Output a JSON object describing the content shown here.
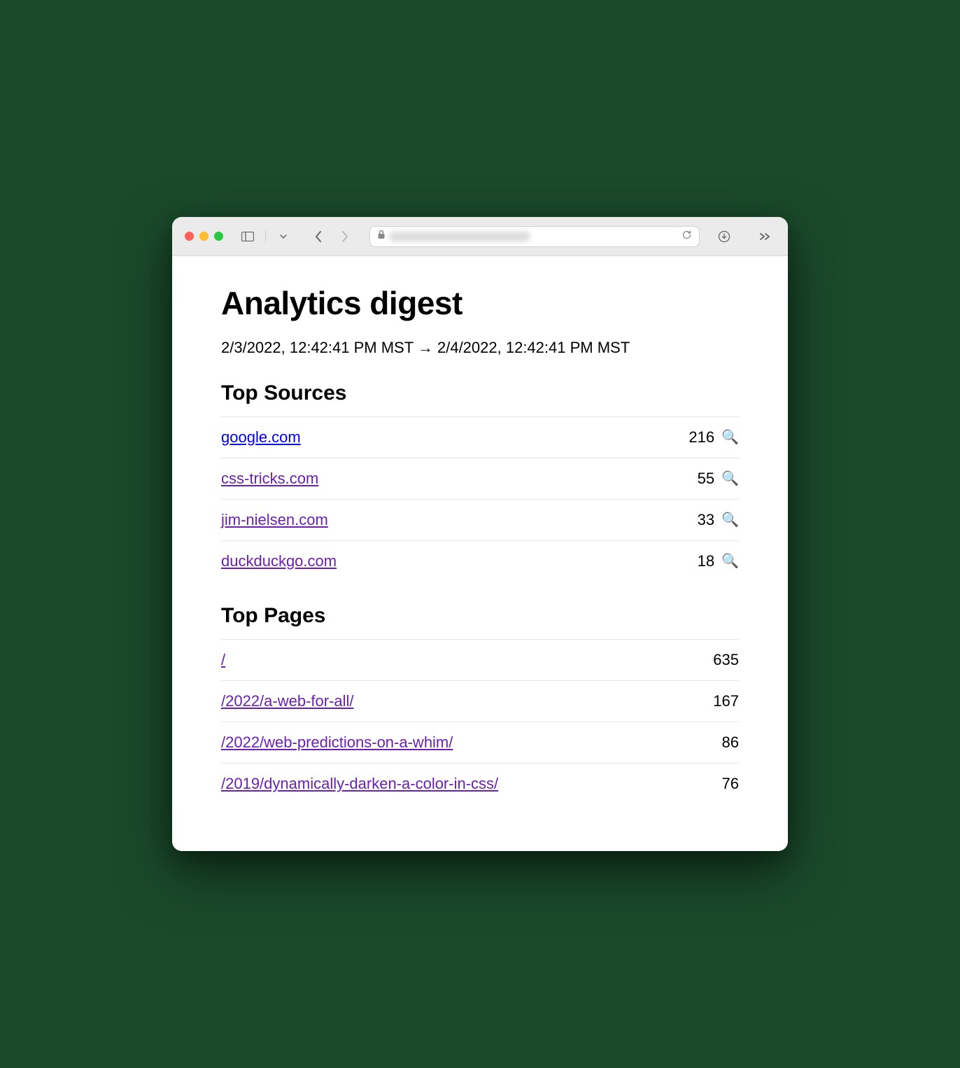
{
  "page": {
    "title": "Analytics digest",
    "date_range": "2/3/2022, 12:42:41 PM MST → 2/4/2022, 12:42:41 PM MST"
  },
  "sections": {
    "sources": {
      "heading": "Top Sources",
      "items": [
        {
          "label": "google.com",
          "value": "216",
          "unvisited": true
        },
        {
          "label": "css-tricks.com",
          "value": "55",
          "unvisited": false
        },
        {
          "label": "jim-nielsen.com",
          "value": "33",
          "unvisited": false
        },
        {
          "label": "duckduckgo.com",
          "value": "18",
          "unvisited": false
        }
      ]
    },
    "pages": {
      "heading": "Top Pages",
      "items": [
        {
          "label": "/",
          "value": "635"
        },
        {
          "label": "/2022/a-web-for-all/",
          "value": "167"
        },
        {
          "label": "/2022/web-predictions-on-a-whim/",
          "value": "86"
        },
        {
          "label": "/2019/dynamically-darken-a-color-in-css/",
          "value": "76"
        }
      ]
    }
  },
  "icons": {
    "magnify": "🔍"
  }
}
